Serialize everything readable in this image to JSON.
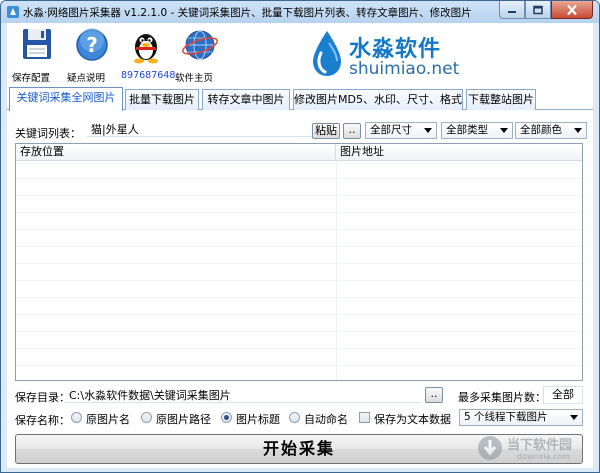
{
  "window": {
    "title": "水淼·网络图片采集器 v1.2.1.0 - 关键词采集图片、批量下载图片列表、转存文章图片、修改图片"
  },
  "toolbar": {
    "items": [
      {
        "label": "保存配置",
        "icon": "save-icon"
      },
      {
        "label": "疑点说明",
        "icon": "help-icon"
      },
      {
        "label": "897687648",
        "icon": "qq-icon"
      },
      {
        "label": "软件主页",
        "icon": "globe-icon"
      }
    ]
  },
  "brand": {
    "name": "水淼软件",
    "url": "shuimiao.net"
  },
  "tabs": [
    {
      "label": "关键词采集全网图片",
      "active": true
    },
    {
      "label": "批量下载图片",
      "active": false
    },
    {
      "label": "转存文章中图片",
      "active": false
    },
    {
      "label": "修改图片MD5、水印、尺寸、格式",
      "active": false
    },
    {
      "label": "下载整站图片",
      "active": false
    }
  ],
  "keyword": {
    "label": "关键词列表：",
    "value": "猫|外星人",
    "paste_label": "粘贴",
    "more_label": "..",
    "size_select": "全部尺寸",
    "type_select": "全部类型",
    "color_select": "全部颜色"
  },
  "list": {
    "columns": [
      "存放位置",
      "图片地址"
    ],
    "rows": []
  },
  "save": {
    "dir_label": "保存目录：",
    "dir_value": "C:\\水淼软件数据\\关键词采集图片",
    "browse_label": "..",
    "max_label": "最多采集图片数：",
    "max_value": "全部",
    "name_label": "保存名称：",
    "options": [
      {
        "label": "原图片名",
        "checked": false
      },
      {
        "label": "原图片路径",
        "checked": false
      },
      {
        "label": "图片标题",
        "checked": true
      },
      {
        "label": "自动命名",
        "checked": false
      }
    ],
    "text_label": "保存为文本数据",
    "text_checked": false,
    "threads_select": "5 个线程下载图片"
  },
  "start_button": "开始采集",
  "watermark": {
    "name": "当下软件园",
    "url": "downxia.com"
  },
  "colors": {
    "brand_blue": "#1478c4",
    "active_tab_text": "#1a5cc8",
    "qq_number": "#1c49d6",
    "title_bar": "#b6d2ee"
  }
}
